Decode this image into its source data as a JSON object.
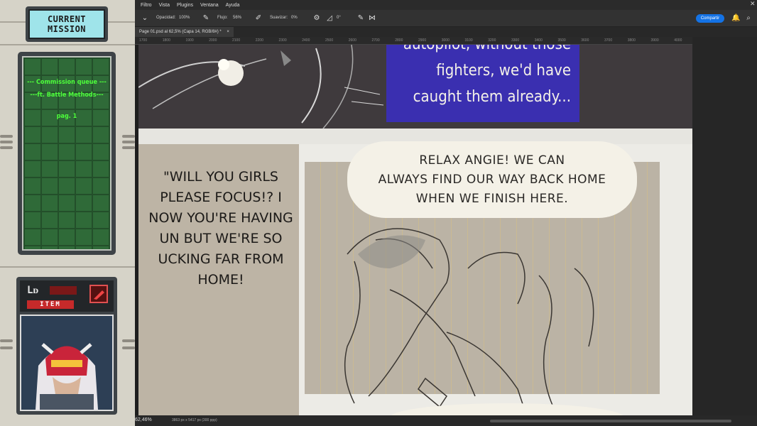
{
  "side_panel": {
    "mission_title": [
      "CURRENT",
      "MISSION"
    ],
    "mission_lines": [
      "--- Commission queue ---",
      "---ft. Battle Methods---",
      "pag. 1"
    ],
    "level_label": "Lᴅ",
    "item_label": "ITEM",
    "colors": {
      "board_green": "#2f6a38",
      "text_green": "#4dff3b",
      "screen_cyan": "#9fe4ea"
    }
  },
  "menubar": {
    "items": [
      "Filtro",
      "Vista",
      "Plugins",
      "Ventana",
      "Ayuda"
    ]
  },
  "optionsbar": {
    "opacity_label": "Opacidad:",
    "opacity_value": "100%",
    "flow_label": "Flujo:",
    "flow_value": "56%",
    "smooth_label": "Suavizar:",
    "smooth_value": "0%",
    "angle_value": "0°",
    "share_label": "Compartir"
  },
  "document_tab": {
    "title": "Page 01.psd al 62,5% (Capa 14, RGB/8#) *",
    "close": "×"
  },
  "ruler_ticks": [
    "1700",
    "1800",
    "1900",
    "2000",
    "2100",
    "2200",
    "2300",
    "2400",
    "2500",
    "2600",
    "2700",
    "2800",
    "2900",
    "3000",
    "3100",
    "3200",
    "3300",
    "3400",
    "3500",
    "3600",
    "3700",
    "3800",
    "3900",
    "4000"
  ],
  "statusbar": {
    "zoom": "62,46%",
    "doc_info": "3863 px x 5417 px (300 ppp)"
  },
  "comic": {
    "narration_lines": [
      "autopilot, without those",
      "fighters, we'd have",
      "caught them already..."
    ],
    "speech_left_lines": [
      "\"WILL YOU GIRLS",
      "PLEASE FOCUS!? I",
      "NOW YOU'RE HAVING",
      "UN BUT WE'RE SO",
      "UCKING FAR FROM",
      "HOME!"
    ],
    "speech_bubble_lines": [
      "RELAX ANGIE! WE CAN",
      "ALWAYS FIND OUR WAY BACK HOME",
      "WHEN WE FINISH HERE."
    ],
    "colors": {
      "narration_bg": "#3a2fb0",
      "panel_dark": "#3f3a3d",
      "panel_sketch": "#bbb3a5"
    }
  }
}
